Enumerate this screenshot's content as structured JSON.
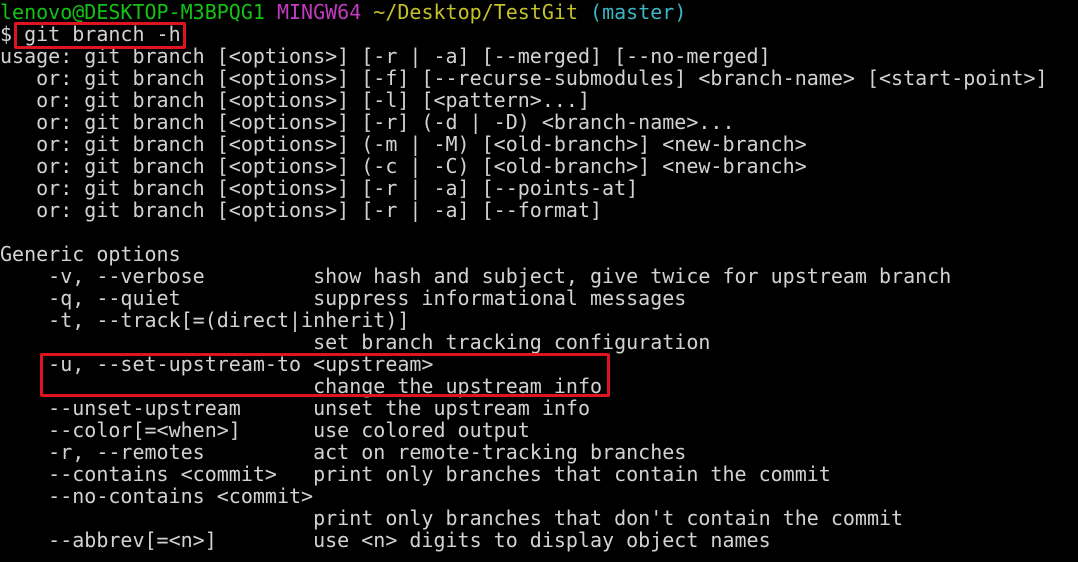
{
  "prompt": {
    "user_host": "lenovo@DESKTOP-M3BPQG1",
    "system": "MINGW64",
    "path": "~/Desktop/TestGit",
    "branch": "(master)"
  },
  "command": {
    "dollar": "$",
    "text": "git branch -h"
  },
  "usage_lines": [
    "usage: git branch [<options>] [-r | -a] [--merged] [--no-merged]",
    "   or: git branch [<options>] [-f] [--recurse-submodules] <branch-name> [<start-point>]",
    "   or: git branch [<options>] [-l] [<pattern>...]",
    "   or: git branch [<options>] [-r] (-d | -D) <branch-name>...",
    "   or: git branch [<options>] (-m | -M) [<old-branch>] <new-branch>",
    "   or: git branch [<options>] (-c | -C) [<old-branch>] <new-branch>",
    "   or: git branch [<options>] [-r | -a] [--points-at]",
    "   or: git branch [<options>] [-r | -a] [--format]"
  ],
  "generic_options": {
    "heading": "Generic options",
    "lines": [
      "    -v, --verbose         show hash and subject, give twice for upstream branch",
      "    -q, --quiet           suppress informational messages",
      "    -t, --track[=(direct|inherit)]",
      "                          set branch tracking configuration",
      "    -u, --set-upstream-to <upstream>",
      "                          change the upstream info",
      "    --unset-upstream      unset the upstream info",
      "    --color[=<when>]      use colored output",
      "    -r, --remotes         act on remote-tracking branches",
      "    --contains <commit>   print only branches that contain the commit",
      "    --no-contains <commit>",
      "                          print only branches that don't contain the commit",
      "    --abbrev[=<n>]        use <n> digits to display object names"
    ]
  },
  "colors": {
    "background": "#000000",
    "text": "#d2d2d2",
    "user_host": "#13c313",
    "system": "#c239c2",
    "path": "#c5c12a",
    "branch": "#3ab6c6",
    "highlight_box": "#e0141e"
  }
}
